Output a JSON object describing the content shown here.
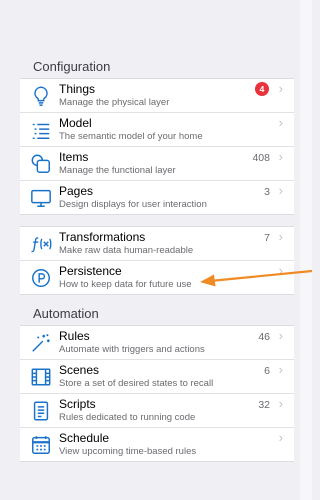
{
  "sections": {
    "configuration": {
      "title": "Configuration"
    },
    "automation": {
      "title": "Automation"
    }
  },
  "items": {
    "things": {
      "title": "Things",
      "subtitle": "Manage the physical layer",
      "badge": "4"
    },
    "model": {
      "title": "Model",
      "subtitle": "The semantic model of your home"
    },
    "items": {
      "title": "Items",
      "subtitle": "Manage the functional layer",
      "count": "408"
    },
    "pages": {
      "title": "Pages",
      "subtitle": "Design displays for user interaction",
      "count": "3"
    },
    "transformations": {
      "title": "Transformations",
      "subtitle": "Make raw data human-readable",
      "count": "7"
    },
    "persistence": {
      "title": "Persistence",
      "subtitle": "How to keep data for future use"
    },
    "rules": {
      "title": "Rules",
      "subtitle": "Automate with triggers and actions",
      "count": "46"
    },
    "scenes": {
      "title": "Scenes",
      "subtitle": "Store a set of desired states to recall",
      "count": "6"
    },
    "scripts": {
      "title": "Scripts",
      "subtitle": "Rules dedicated to running code",
      "count": "32"
    },
    "schedule": {
      "title": "Schedule",
      "subtitle": "View upcoming time-based rules"
    }
  },
  "icons": {
    "things": "lightbulb-icon",
    "model": "list-icon",
    "items": "squares-icon",
    "pages": "monitor-icon",
    "transformations": "function-icon",
    "persistence": "persistence-icon",
    "rules": "magic-wand-icon",
    "scenes": "film-icon",
    "scripts": "document-icon",
    "schedule": "calendar-icon"
  },
  "colors": {
    "accent": "#1a73c9",
    "badge": "#e8323c",
    "arrow": "#f08a24"
  }
}
